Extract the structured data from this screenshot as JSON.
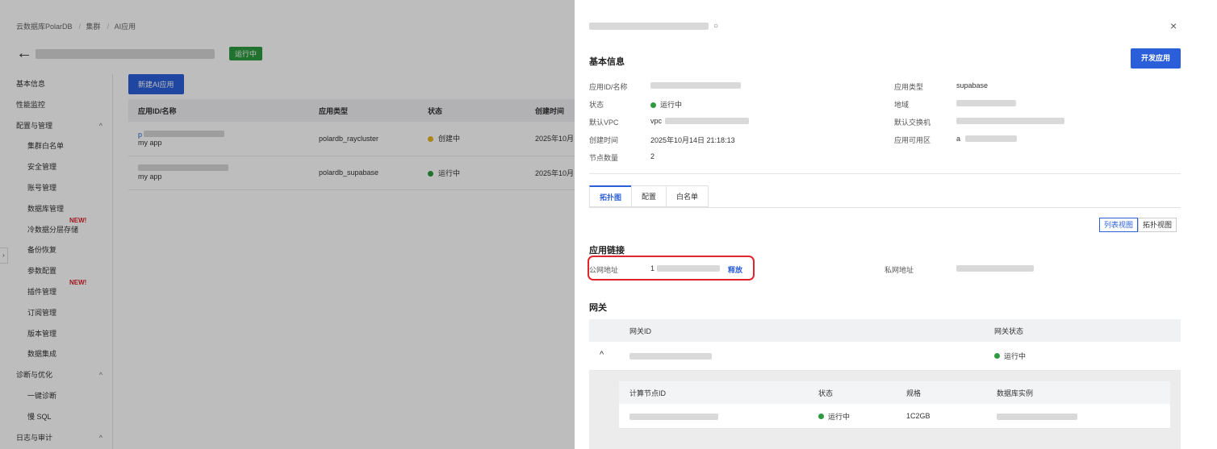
{
  "bg": {
    "breadcrumb": [
      "云数据库PolarDB",
      "集群",
      "AI应用"
    ],
    "back_arrow": "←",
    "status_tag": "运行中",
    "sidebar": [
      {
        "label": "基本信息",
        "sub": false
      },
      {
        "label": "性能监控",
        "sub": false
      },
      {
        "label": "配置与管理",
        "sub": false,
        "chev": "^"
      },
      {
        "label": "集群白名单",
        "sub": true
      },
      {
        "label": "安全管理",
        "sub": true
      },
      {
        "label": "账号管理",
        "sub": true
      },
      {
        "label": "数据库管理",
        "sub": true
      },
      {
        "label": "冷数据分层存储",
        "sub": true,
        "badge": "NEW!"
      },
      {
        "label": "备份恢复",
        "sub": true
      },
      {
        "label": "参数配置",
        "sub": true
      },
      {
        "label": "插件管理",
        "sub": true,
        "badge": "NEW!"
      },
      {
        "label": "订阅管理",
        "sub": true
      },
      {
        "label": "版本管理",
        "sub": true
      },
      {
        "label": "数据集成",
        "sub": true
      },
      {
        "label": "诊断与优化",
        "sub": false,
        "chev": "^"
      },
      {
        "label": "一键诊断",
        "sub": true
      },
      {
        "label": "慢 SQL",
        "sub": true
      },
      {
        "label": "日志与审计",
        "sub": false,
        "chev": "^"
      }
    ],
    "create_button": "新建AI应用",
    "table": {
      "headers": [
        "应用ID/名称",
        "应用类型",
        "状态",
        "创建时间"
      ],
      "rows": [
        {
          "id": "p",
          "name": "my app",
          "type": "polardb_raycluster",
          "status": "创建中",
          "status_color": "#e6b422",
          "created": "2025年10月"
        },
        {
          "id": "",
          "name": "my app",
          "type": "polardb_supabase",
          "status": "运行中",
          "status_color": "#2d9a3f",
          "created": "2025年10月"
        }
      ]
    }
  },
  "drawer": {
    "refresh_icon": "○",
    "close_icon": "×",
    "basic_title": "基本信息",
    "dev_button": "开发应用",
    "info": {
      "app_id_label": "应用ID/名称",
      "status_label": "状态",
      "status_value": "运行中",
      "vpc_label": "默认VPC",
      "vpc_value": "vpc",
      "created_label": "创建时间",
      "created_value": "2025年10月14日 21:18:13",
      "nodes_label": "节点数量",
      "nodes_value": "2",
      "type_label": "应用类型",
      "type_value": "supabase",
      "region_label": "地域",
      "vswitch_label": "默认交换机",
      "zone_label": "应用可用区",
      "zone_value": "a"
    },
    "tabs": [
      "拓扑图",
      "配置",
      "白名单"
    ],
    "views": [
      "列表视图",
      "拓扑视图"
    ],
    "link_title": "应用链接",
    "public_label": "公网地址",
    "public_value": "1",
    "release_link": "释放",
    "private_label": "私网地址",
    "gateway_title": "网关",
    "gateway_headers": [
      "网关ID",
      "网关状态"
    ],
    "gateway_status": "运行中",
    "expand_icon": "^",
    "node_headers": [
      "计算节点ID",
      "状态",
      "规格",
      "数据库实例"
    ],
    "node_row": {
      "status": "运行中",
      "spec": "1C2GB"
    },
    "status_color": "#2d9a3f"
  }
}
